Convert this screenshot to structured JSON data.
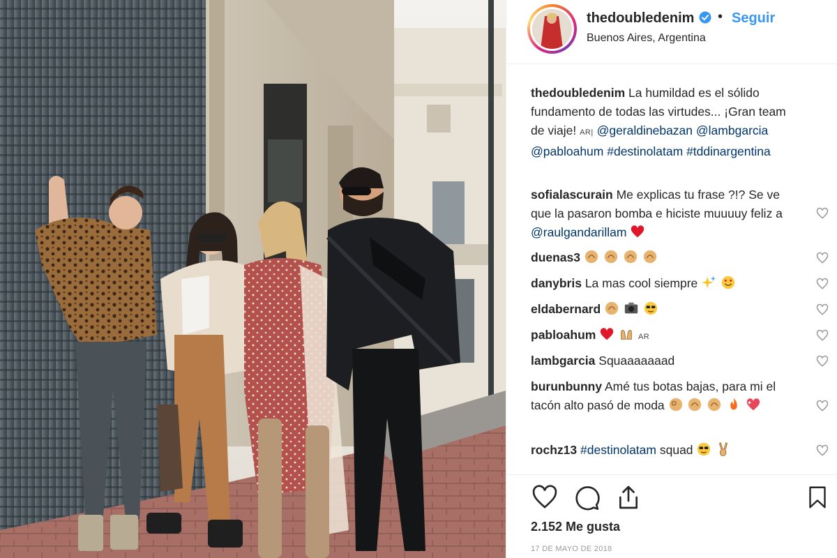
{
  "post": {
    "username": "thedoubledenim",
    "follow_label": "Seguir",
    "dot": "•",
    "location": "Buenos Aires, Argentina",
    "likes": "2.152 Me gusta",
    "date": "17 DE MAYO DE 2018"
  },
  "caption": {
    "username": "thedoubledenim",
    "text": "La humildad es el sólido fundamento de todas las virtudes... ¡Gran team de viaje!",
    "flag": "AR|",
    "mentions": [
      "@geraldinebazan",
      "@lambgarcia",
      "@pabloahum"
    ],
    "hashtags": [
      "#destinolatam",
      "#tddinargentina"
    ]
  },
  "comments": [
    {
      "username": "sofialascurain",
      "text_a": "Me explicas tu frase ?!? Se ve que la pasaron bomba e hiciste muuuuy feliz a",
      "mention": "@raulgandarillam"
    },
    {
      "username": "duenas3"
    },
    {
      "username": "danybris",
      "text": "La mas cool siempre"
    },
    {
      "username": "eldabernard"
    },
    {
      "username": "pabloahum",
      "flag": "AR"
    },
    {
      "username": "lambgarcia",
      "text": "Squaaaaaaad"
    },
    {
      "username": "burunbunny",
      "text": "Amé tus botas bajas, para mi el tacón alto pasó de moda"
    },
    {
      "username": "rochz13",
      "hashtag": "#destinolatam",
      "text": "squad"
    }
  ],
  "icons": [
    "verified-badge-icon",
    "heart-icon",
    "comment-icon",
    "share-icon",
    "bookmark-icon"
  ],
  "colors": {
    "link": "#003569",
    "follow": "#3897f0",
    "verified": "#3897f0",
    "heart": "#ed4956"
  }
}
